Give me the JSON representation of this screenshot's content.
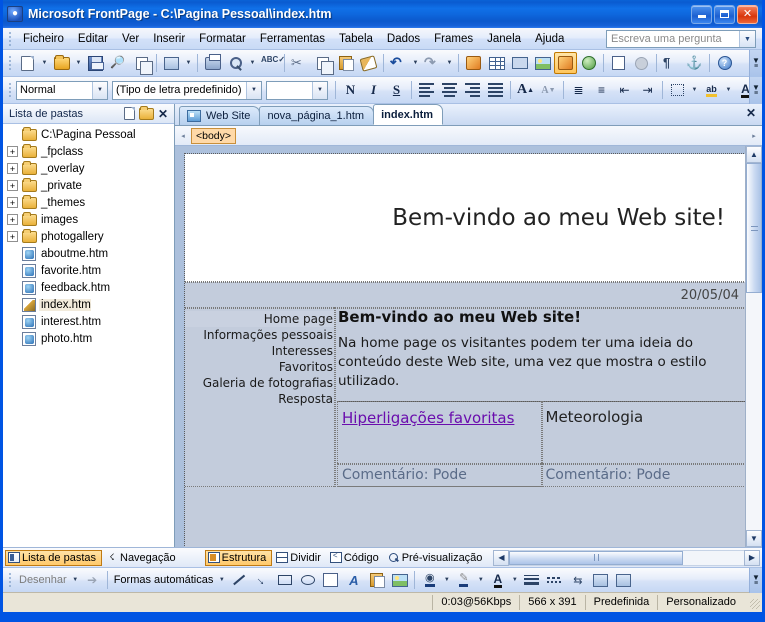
{
  "window": {
    "title": "Microsoft FrontPage - C:\\Pagina Pessoal\\index.htm",
    "app_icon": "frontpage-icon",
    "minimize": "–",
    "maximize": "□",
    "close": "✕"
  },
  "menu": {
    "items": [
      {
        "label": "Ficheiro"
      },
      {
        "label": "Editar"
      },
      {
        "label": "Ver"
      },
      {
        "label": "Inserir"
      },
      {
        "label": "Formatar"
      },
      {
        "label": "Ferramentas"
      },
      {
        "label": "Tabela"
      },
      {
        "label": "Dados"
      },
      {
        "label": "Frames"
      },
      {
        "label": "Janela"
      },
      {
        "label": "Ajuda"
      }
    ],
    "ask_placeholder": "Escreva uma pergunta"
  },
  "standard_toolbar": {
    "buttons": [
      {
        "name": "new-page-button",
        "icon": "new-page-icon"
      },
      {
        "name": "open-button",
        "icon": "open-folder-icon"
      },
      {
        "name": "save-button",
        "icon": "save-disk-icon"
      },
      {
        "name": "search-button",
        "icon": "binoculars-icon"
      },
      {
        "name": "publish-button",
        "icon": "publish-site-icon"
      },
      {
        "name": "toggle-pane-button",
        "icon": "task-pane-icon"
      },
      {
        "name": "print-button",
        "icon": "printer-icon"
      },
      {
        "name": "print-preview-button",
        "icon": "print-preview-icon"
      },
      {
        "name": "spelling-button",
        "icon": "spelling-abc-icon"
      },
      {
        "name": "cut-button",
        "icon": "scissors-icon"
      },
      {
        "name": "copy-button",
        "icon": "copy-icon"
      },
      {
        "name": "paste-button",
        "icon": "paste-icon"
      },
      {
        "name": "format-painter-button",
        "icon": "format-painter-icon"
      },
      {
        "name": "undo-button",
        "icon": "undo-arrow-icon"
      },
      {
        "name": "redo-button",
        "icon": "redo-arrow-icon"
      },
      {
        "name": "web-component-button",
        "icon": "web-component-icon"
      },
      {
        "name": "insert-table-button",
        "icon": "table-icon"
      },
      {
        "name": "layout-table-button",
        "icon": "layout-table-icon"
      },
      {
        "name": "insert-picture-button",
        "icon": "picture-icon"
      },
      {
        "name": "drawing-button",
        "icon": "drawing-icon"
      },
      {
        "name": "hyperlink-button",
        "icon": "hyperlink-globe-icon"
      },
      {
        "name": "refresh-button",
        "icon": "refresh-icon"
      },
      {
        "name": "stop-button",
        "icon": "stop-icon"
      },
      {
        "name": "show-marks-button",
        "icon": "pilcrow-icon"
      },
      {
        "name": "bookmark-button",
        "icon": "anchor-icon"
      },
      {
        "name": "help-button",
        "icon": "help-question-icon"
      }
    ],
    "overflow": "toolbar-options-icon"
  },
  "format_toolbar": {
    "style": {
      "value": "Normal"
    },
    "font": {
      "value": "(Tipo de letra predefinido)"
    },
    "size": {
      "value": ""
    },
    "buttons": [
      {
        "name": "bold-button",
        "glyph": "N"
      },
      {
        "name": "italic-button",
        "glyph": "I"
      },
      {
        "name": "underline-button",
        "glyph": "S"
      },
      {
        "name": "align-left-button",
        "glyph": "≡"
      },
      {
        "name": "align-center-button",
        "glyph": "≡"
      },
      {
        "name": "align-right-button",
        "glyph": "≡"
      },
      {
        "name": "justify-button",
        "glyph": "≡"
      },
      {
        "name": "increase-font-size-button",
        "glyph": "A"
      },
      {
        "name": "decrease-font-size-button",
        "glyph": "A"
      },
      {
        "name": "numbered-list-button",
        "glyph": "≣"
      },
      {
        "name": "bulleted-list-button",
        "glyph": "≣"
      },
      {
        "name": "decrease-indent-button",
        "glyph": "⇤"
      },
      {
        "name": "increase-indent-button",
        "glyph": "⇥"
      },
      {
        "name": "borders-button",
        "glyph": "▦"
      },
      {
        "name": "highlight-color-button",
        "glyph": "ab"
      },
      {
        "name": "font-color-button",
        "glyph": "A"
      }
    ]
  },
  "folder_list": {
    "title": "Lista de pastas",
    "new_page_icon": "new-page-icon",
    "new_folder_icon": "new-folder-icon",
    "close_icon": "close-icon",
    "root": {
      "label": "C:\\Pagina Pessoal",
      "icon": "folder-icon"
    },
    "nodes": [
      {
        "label": "_fpclass",
        "type": "folder",
        "expandable": true,
        "expander": "+",
        "selected": false
      },
      {
        "label": "_overlay",
        "type": "folder",
        "expandable": true,
        "expander": "+",
        "selected": false
      },
      {
        "label": "_private",
        "type": "folder",
        "expandable": true,
        "expander": "+",
        "selected": false
      },
      {
        "label": "_themes",
        "type": "folder",
        "expandable": true,
        "expander": "+",
        "selected": false
      },
      {
        "label": "images",
        "type": "folder",
        "expandable": true,
        "expander": "+",
        "selected": false
      },
      {
        "label": "photogallery",
        "type": "folder",
        "expandable": true,
        "expander": "+",
        "selected": false
      },
      {
        "label": "aboutme.htm",
        "type": "html",
        "expandable": false,
        "expander": "",
        "selected": false
      },
      {
        "label": "favorite.htm",
        "type": "html",
        "expandable": false,
        "expander": "",
        "selected": false
      },
      {
        "label": "feedback.htm",
        "type": "html",
        "expandable": false,
        "expander": "",
        "selected": false
      },
      {
        "label": "index.htm",
        "type": "home",
        "expandable": false,
        "expander": "",
        "selected": true
      },
      {
        "label": "interest.htm",
        "type": "html",
        "expandable": false,
        "expander": "",
        "selected": false
      },
      {
        "label": "photo.htm",
        "type": "html",
        "expandable": false,
        "expander": "",
        "selected": false
      }
    ]
  },
  "document_tabs": {
    "tabs": [
      {
        "label": "Web Site",
        "active": false,
        "has_icon": true
      },
      {
        "label": "nova_página_1.htm",
        "active": false,
        "has_icon": false
      },
      {
        "label": "index.htm",
        "active": true,
        "has_icon": false
      }
    ],
    "close_icon": "close-icon"
  },
  "quick_tag": {
    "tag": "<body>",
    "left_arrow": "◂",
    "right_arrow": "▸"
  },
  "page": {
    "banner_title": "Bem-vindo ao meu Web site!",
    "date": "20/05/04",
    "nav_links": [
      "Home page",
      "Informações pessoais",
      "Interesses",
      "Favoritos",
      "Galeria de fotografias",
      "Resposta"
    ],
    "content_heading": "Bem-vindo ao meu Web site!",
    "content_paragraph": "Na home page os visitantes podem ter uma ideia do conteúdo deste Web site, uma vez que mostra o estilo utilizado.",
    "left_column_link": "Hiperligações favoritas",
    "right_column_title": "Meteorologia",
    "comment_left": "Comentário: Pode",
    "comment_right": "Comentário: Pode",
    "link_color": "#6A0DAD"
  },
  "view_bar": {
    "left_tabs": [
      {
        "label": "Lista de pastas",
        "active": true,
        "icon": "folder-list-icon"
      },
      {
        "label": "Navegação",
        "active": false,
        "icon": "navigation-icon"
      }
    ],
    "view_tabs": [
      {
        "label": "Estrutura",
        "active": true,
        "icon": "design-view-icon"
      },
      {
        "label": "Dividir",
        "active": false,
        "icon": "split-view-icon"
      },
      {
        "label": "Código",
        "active": false,
        "icon": "code-view-icon"
      },
      {
        "label": "Pré-visualização",
        "active": false,
        "icon": "preview-view-icon"
      }
    ],
    "scroll_left": "◂",
    "scroll_right": "▸"
  },
  "drawing_toolbar": {
    "draw_label": "Desenhar",
    "autoshapes_label": "Formas automáticas",
    "buttons": [
      {
        "name": "select-objects-button",
        "icon": "arrow-cursor-icon"
      },
      {
        "name": "line-button",
        "icon": "line-icon"
      },
      {
        "name": "arrow-button",
        "icon": "arrow-icon"
      },
      {
        "name": "rectangle-button",
        "icon": "rectangle-icon"
      },
      {
        "name": "oval-button",
        "icon": "oval-icon"
      },
      {
        "name": "text-box-button",
        "icon": "text-box-icon"
      },
      {
        "name": "wordart-button",
        "icon": "wordart-icon"
      },
      {
        "name": "clip-art-button",
        "icon": "clip-art-icon"
      },
      {
        "name": "insert-picture-button",
        "icon": "picture-icon"
      },
      {
        "name": "fill-color-button",
        "icon": "fill-color-icon"
      },
      {
        "name": "line-color-button",
        "icon": "line-color-icon"
      },
      {
        "name": "font-color-button",
        "icon": "font-color-icon"
      },
      {
        "name": "line-style-button",
        "icon": "line-style-icon"
      },
      {
        "name": "dash-style-button",
        "icon": "dash-style-icon"
      },
      {
        "name": "arrow-style-button",
        "icon": "arrow-style-icon"
      },
      {
        "name": "shadow-style-button",
        "icon": "shadow-style-icon"
      },
      {
        "name": "3d-style-button",
        "icon": "3d-style-icon"
      }
    ]
  },
  "status_bar": {
    "download_time": "0:03@56Kbps",
    "dimensions": "566 x 391",
    "schema": "Predefinida",
    "css": "Personalizado"
  }
}
